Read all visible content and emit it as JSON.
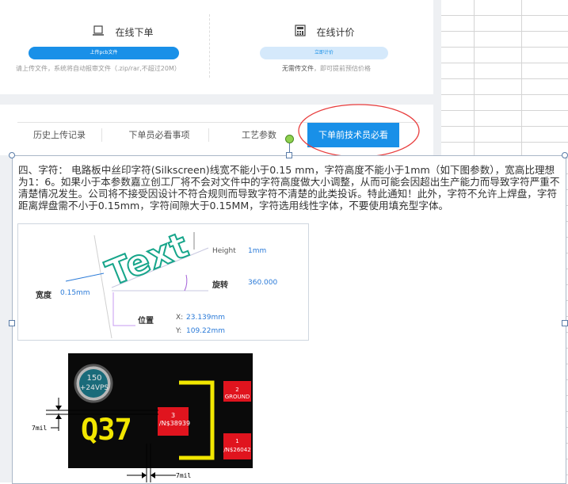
{
  "services": {
    "online_order": {
      "title": "在线下单",
      "button": "上传pcb文件",
      "note": "请上传文件，系统将自动报审文件（.zip/rar,不超过20M）",
      "icon": "laptop-icon"
    },
    "online_quote": {
      "title": "在线计价",
      "button": "立即计价",
      "note_bold": "无需传文件",
      "note_rest": "，即可提前预估价格",
      "icon": "calculator-icon"
    }
  },
  "tabs": [
    {
      "label": "历史上传记录"
    },
    {
      "label": "下单员必看事项"
    },
    {
      "label": "工艺参数"
    },
    {
      "label": "下单前技术员必看"
    }
  ],
  "active_tab_index": 3,
  "document": {
    "paragraph": "四、字符： 电路板中丝印字符(Silkscreen)线宽不能小于0.15 mm，字符高度不能小于1mm（如下图参数），宽高比理想为1：6。如果小于本参数嘉立创工厂将不会对文件中的字符高度做大小调整，从而可能会因超出生产能力而导致字符严重不清楚情况发生。公司将不接受因设计不符合规则而导致字符不清楚的此类投诉。特此通知！此外，字符不允许上焊盘，字符距离焊盘需不小于0.15mm，字符间隙大于0.15MM，字符选用线性字体，不要使用填充型字体。"
  },
  "figure1": {
    "text_sample": "Text",
    "height_label": "Height",
    "height_value": "1mm",
    "rotation_label": "旋转",
    "rotation_value": "360.000",
    "width_label": "宽度",
    "width_value": "0.15mm",
    "position_label": "位置",
    "x_label": "X:",
    "x_value": "23.139mm",
    "y_label": "Y:",
    "y_value": "109.22mm"
  },
  "figure2": {
    "cap_line1": "150",
    "cap_line2": "+24VPS",
    "ref": "Q37",
    "pad3_num": "3",
    "pad3_net": "/N$38939",
    "pad2_num": "2",
    "pad2_net": "GROUND",
    "pad1_num": "1",
    "pad1_net": "/N$26042",
    "dim_left": "7mil",
    "dim_bottom": "7mil"
  },
  "colors": {
    "accent": "#1990e8",
    "highlight_circle": "#e83c3c",
    "silk_yellow": "#f2e600",
    "pad_red": "#e0141e",
    "text_teal": "#16a58a"
  }
}
